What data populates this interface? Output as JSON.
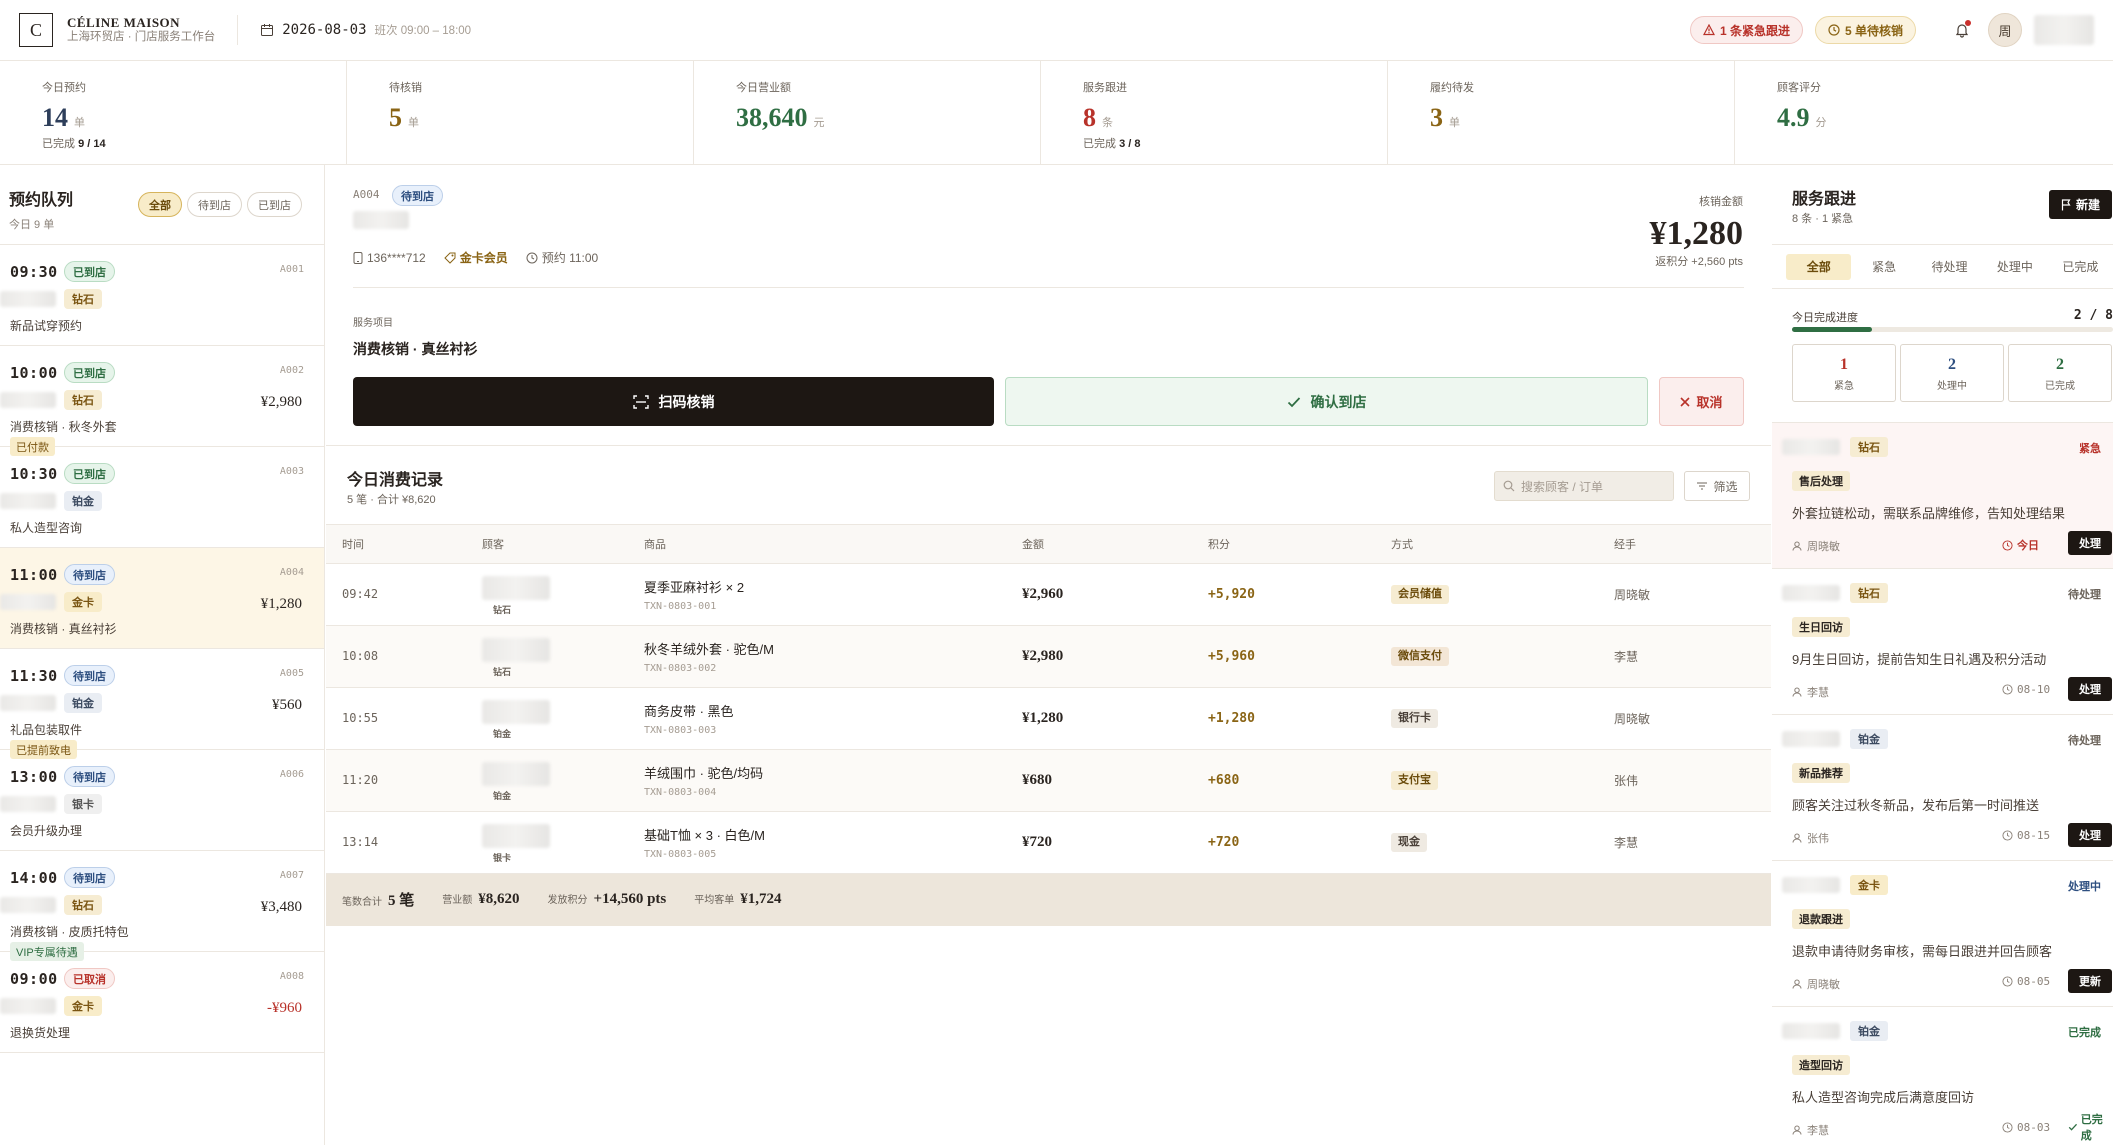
{
  "header": {
    "logo": "C",
    "brand": "CÉLINE MAISON",
    "store": "上海环贸店 · 门店服务工作台",
    "date": "2026-08-03",
    "shift": "班次 09:00 – 18:00",
    "urgent_pill": "1 条紧急跟进",
    "pending_pill": "5 单待核销",
    "avatar": "周"
  },
  "stats": [
    {
      "label": "今日预约",
      "value": "14",
      "unit": "单",
      "sub_prefix": "已完成",
      "sub_value": "9 / 14",
      "color": "#2d3e5a"
    },
    {
      "label": "待核销",
      "value": "5",
      "unit": "单",
      "sub_prefix": "",
      "sub_value": "",
      "color": "#8a6415"
    },
    {
      "label": "今日营业额",
      "value": "38,640",
      "unit": "元",
      "sub_prefix": "",
      "sub_value": "",
      "color": "#2f6e43"
    },
    {
      "label": "服务跟进",
      "value": "8",
      "unit": "条",
      "sub_prefix": "已完成",
      "sub_value": "3 / 8",
      "color": "#b8322a"
    },
    {
      "label": "履约待发",
      "value": "3",
      "unit": "单",
      "sub_prefix": "",
      "sub_value": "",
      "color": "#8a6415"
    },
    {
      "label": "顾客评分",
      "value": "4.9",
      "unit": "分",
      "sub_prefix": "",
      "sub_value": "",
      "color": "#2f6e43"
    }
  ],
  "queue": {
    "title": "预约队列",
    "subtitle": "今日 9 单",
    "filters": [
      "全部",
      "待到店",
      "已到店"
    ],
    "items": [
      {
        "time": "09:30",
        "status": "已到店",
        "status_cls": "b-arr",
        "id": "A001",
        "tier": "钻石",
        "tier_cls": "t-dia",
        "amount": "",
        "service": "新品试穿预约",
        "tag": "",
        "tag_cls": ""
      },
      {
        "time": "10:00",
        "status": "已到店",
        "status_cls": "b-arr",
        "id": "A002",
        "tier": "钻石",
        "tier_cls": "t-dia",
        "amount": "¥2,980",
        "service": "消费核销 · 秋冬外套",
        "tag": "已付款",
        "tag_cls": ""
      },
      {
        "time": "10:30",
        "status": "已到店",
        "status_cls": "b-arr",
        "id": "A003",
        "tier": "铂金",
        "tier_cls": "t-pla",
        "amount": "",
        "service": "私人造型咨询",
        "tag": "",
        "tag_cls": ""
      },
      {
        "time": "11:00",
        "status": "待到店",
        "status_cls": "b-wait",
        "id": "A004",
        "tier": "金卡",
        "tier_cls": "t-gold",
        "amount": "¥1,280",
        "service": "消费核销 · 真丝衬衫",
        "tag": "",
        "tag_cls": "",
        "selected": true
      },
      {
        "time": "11:30",
        "status": "待到店",
        "status_cls": "b-wait",
        "id": "A005",
        "tier": "铂金",
        "tier_cls": "t-pla",
        "amount": "¥560",
        "service": "礼品包装取件",
        "tag": "已提前致电",
        "tag_cls": ""
      },
      {
        "time": "13:00",
        "status": "待到店",
        "status_cls": "b-wait",
        "id": "A006",
        "tier": "银卡",
        "tier_cls": "t-sil",
        "amount": "",
        "service": "会员升级办理",
        "tag": "",
        "tag_cls": ""
      },
      {
        "time": "14:00",
        "status": "待到店",
        "status_cls": "b-wait",
        "id": "A007",
        "tier": "钻石",
        "tier_cls": "t-dia",
        "amount": "¥3,480",
        "service": "消费核销 · 皮质托特包",
        "tag": "VIP专属待遇",
        "tag_cls": "blue"
      },
      {
        "time": "09:00",
        "status": "已取消",
        "status_cls": "b-cancel",
        "id": "A008",
        "tier": "金卡",
        "tier_cls": "t-gold",
        "amount": "-¥960",
        "service": "退换货处理",
        "tag": "",
        "tag_cls": ""
      }
    ]
  },
  "detail": {
    "code": "A004",
    "status": "待到店",
    "phone": "136****712",
    "tier": "金卡会员",
    "appt": "预约 11:00",
    "amount_label": "核销金额",
    "amount": "¥1,280",
    "points": "返积分 +2,560 pts",
    "service_label": "服务项目",
    "service": "消费核销 · 真丝衬衫",
    "scan": "扫码核销",
    "confirm": "确认到店",
    "cancel": "取消"
  },
  "records": {
    "title": "今日消费记录",
    "subtitle": "5 笔 · 合计 ¥8,620",
    "search_placeholder": "搜索顾客 / 订单",
    "filter": "筛选",
    "columns": [
      "时间",
      "顾客",
      "商品",
      "金额",
      "积分",
      "方式",
      "经手"
    ],
    "rows": [
      {
        "time": "09:42",
        "tier": "钻石",
        "product": "夏季亚麻衬衫 × 2",
        "code": "TXN-0803-001",
        "amount": "¥2,960",
        "points": "+5,920",
        "method": "会员储值",
        "mcls": "p-mem",
        "staff": "周晓敏"
      },
      {
        "time": "10:08",
        "tier": "钻石",
        "product": "秋冬羊绒外套 · 驼色/M",
        "code": "TXN-0803-002",
        "amount": "¥2,980",
        "points": "+5,960",
        "method": "微信支付",
        "mcls": "p-wx",
        "staff": "李慧"
      },
      {
        "time": "10:55",
        "tier": "铂金",
        "product": "商务皮带 · 黑色",
        "code": "TXN-0803-003",
        "amount": "¥1,280",
        "points": "+1,280",
        "method": "银行卡",
        "mcls": "p-bank",
        "staff": "周晓敏"
      },
      {
        "time": "11:20",
        "tier": "铂金",
        "product": "羊绒围巾 · 驼色/均码",
        "code": "TXN-0803-004",
        "amount": "¥680",
        "points": "+680",
        "method": "支付宝",
        "mcls": "p-ali",
        "staff": "张伟"
      },
      {
        "time": "13:14",
        "tier": "银卡",
        "product": "基础T恤 × 3 · 白色/M",
        "code": "TXN-0803-005",
        "amount": "¥720",
        "points": "+720",
        "method": "现金",
        "mcls": "p-cash",
        "staff": "李慧"
      }
    ],
    "footer": {
      "count_label": "笔数合计",
      "count": "5 笔",
      "rev_label": "营业额",
      "rev": "¥8,620",
      "pts_label": "发放积分",
      "pts": "+14,560 pts",
      "avg_label": "平均客单",
      "avg": "¥1,724"
    }
  },
  "follow": {
    "title": "服务跟进",
    "subtitle": "8 条 · 1 紧急",
    "new": "新建",
    "tabs": [
      "全部",
      "紧急",
      "待处理",
      "处理中",
      "已完成"
    ],
    "progress_label": "今日完成进度",
    "progress_text": "2 / 8",
    "progress": 0.25,
    "boxes": [
      {
        "n": "1",
        "t": "紧急",
        "c": "#b8322a"
      },
      {
        "n": "2",
        "t": "处理中",
        "c": "#2e4f80"
      },
      {
        "n": "2",
        "t": "已完成",
        "c": "#2f6e43"
      }
    ],
    "items": [
      {
        "tier": "钻石",
        "tier_cls": "t-dia",
        "status": "紧急",
        "scls": "s-urg",
        "type": "售后处理",
        "desc": "外套拉链松动，需联系品牌维修，告知处理结果",
        "staff": "周晓敏",
        "date": "今日",
        "date_red": true,
        "action": "处理",
        "urgent": true
      },
      {
        "tier": "钻石",
        "tier_cls": "t-dia",
        "status": "待处理",
        "scls": "s-pend",
        "type": "生日回访",
        "desc": "9月生日回访，提前告知生日礼遇及积分活动",
        "staff": "李慧",
        "date": "08-10",
        "action": "处理"
      },
      {
        "tier": "铂金",
        "tier_cls": "t-pla",
        "status": "待处理",
        "scls": "s-pend",
        "type": "新品推荐",
        "desc": "顾客关注过秋冬新品，发布后第一时间推送",
        "staff": "张伟",
        "date": "08-15",
        "action": "处理"
      },
      {
        "tier": "金卡",
        "tier_cls": "t-gold",
        "status": "处理中",
        "scls": "s-proc",
        "type": "退款跟进",
        "desc": "退款申请待财务审核，需每日跟进并回告顾客",
        "staff": "周晓敏",
        "date": "08-05",
        "action": "更新"
      },
      {
        "tier": "铂金",
        "tier_cls": "t-pla",
        "status": "已完成",
        "scls": "s-done",
        "type": "造型回访",
        "desc": "私人造型咨询完成后满意度回访",
        "staff": "李慧",
        "date": "08-03",
        "action": "已完成",
        "done": true
      }
    ]
  }
}
